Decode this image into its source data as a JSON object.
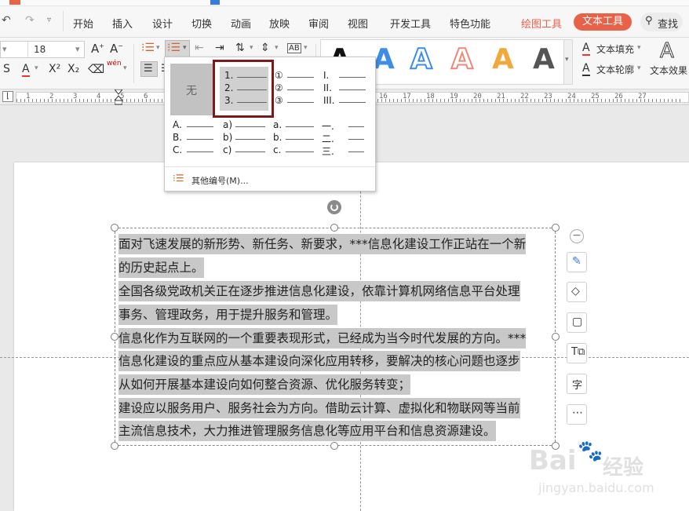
{
  "menubar": {
    "items": [
      "开始",
      "插入",
      "设计",
      "切换",
      "动画",
      "放映",
      "审阅",
      "视图",
      "开发工具",
      "特色功能"
    ],
    "drawing_tools": "绘图工具",
    "text_tools": "文本工具",
    "search": "查找"
  },
  "toolbar": {
    "font_size": "18",
    "text_fill": "文本填充",
    "text_outline": "文本轮廓",
    "text_effect": "文本效果",
    "wen": "wén",
    "style_letter": "A"
  },
  "ruler": {
    "numbers": [
      "1",
      "2",
      "3",
      "4",
      "5",
      "6",
      "7",
      "8",
      "9",
      "10",
      "11",
      "12",
      "13",
      "14",
      "15",
      "16",
      "17",
      "18",
      "19",
      "20",
      "21",
      "22",
      "23",
      "24",
      "25",
      "26",
      "27"
    ]
  },
  "numbering_dropdown": {
    "none_label": "无",
    "styles": [
      [
        "1.",
        "2.",
        "3."
      ],
      [
        "①",
        "②",
        "③"
      ],
      [
        "I.",
        "II.",
        "III."
      ],
      [
        "A.",
        "B.",
        "C."
      ],
      [
        "a)",
        "b)",
        "c)"
      ],
      [
        "a.",
        "b.",
        "c."
      ],
      [
        "一.",
        "二.",
        "三."
      ]
    ],
    "more_label": "其他编号(M)..."
  },
  "document": {
    "lines": [
      "面对飞速发展的新形势、新任务、新要求，***信息化建设工作正站在一个新",
      "的历史起点上。",
      "全国各级党政机关正在逐步推进信息化建设，依靠计算机网络信息平台处理",
      "事务、管理政务，用于提升服务和管理。",
      "信息化作为互联网的一个重要表现形式，已经成为当今时代发展的方向。***",
      "信息化建设的重点应从基本建设向深化应用转移，要解决的核心问题也逐步",
      "从如何开展基本建设向如何整合资源、优化服务转变；",
      "建设应以服务用户、服务社会为方向。借助云计算、虚拟化和物联网等当前",
      "主流信息技术，大力推进管理服务信息化等应用平台和信息资源建设。"
    ]
  },
  "side_toolbar": {
    "zi": "字"
  },
  "watermark": {
    "brand": "Bai",
    "brand_suffix": "经验",
    "url": "jingyan.baidu.com"
  },
  "colors": {
    "accent": "#e8624a",
    "selection": "#c8c8c8",
    "dropdown_highlight": "#7a1a1a"
  }
}
